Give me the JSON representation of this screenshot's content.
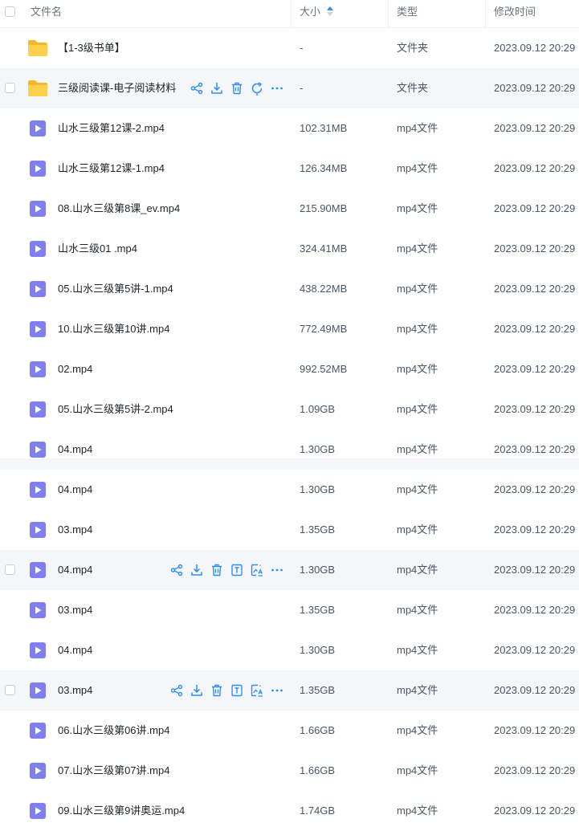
{
  "header": {
    "name_label": "文件名",
    "size_label": "大小",
    "type_label": "类型",
    "time_label": "修改时间"
  },
  "colors": {
    "accent": "#2b8ef6",
    "folder": "#f8c236",
    "video": "#7f7ff0"
  },
  "rows": [
    {
      "name": "【1-3级书单】",
      "size": "-",
      "type": "文件夹",
      "time": "2023.09.12 20:29",
      "icon": "folder-icon"
    },
    {
      "name": "三级阅读课-电子阅读材料",
      "size": "-",
      "type": "文件夹",
      "time": "2023.09.12 20:29",
      "icon": "folder-icon"
    },
    {
      "name": "山水三级第12课-2.mp4",
      "size": "102.31MB",
      "type": "mp4文件",
      "time": "2023.09.12 20:29",
      "icon": "video-file-icon"
    },
    {
      "name": "山水三级第12课-1.mp4",
      "size": "126.34MB",
      "type": "mp4文件",
      "time": "2023.09.12 20:29",
      "icon": "video-file-icon"
    },
    {
      "name": "08.山水三级第8课_ev.mp4",
      "size": "215.90MB",
      "type": "mp4文件",
      "time": "2023.09.12 20:29",
      "icon": "video-file-icon"
    },
    {
      "name": "山水三级01 .mp4",
      "size": "324.41MB",
      "type": "mp4文件",
      "time": "2023.09.12 20:29",
      "icon": "video-file-icon"
    },
    {
      "name": "05.山水三级第5讲-1.mp4",
      "size": "438.22MB",
      "type": "mp4文件",
      "time": "2023.09.12 20:29",
      "icon": "video-file-icon"
    },
    {
      "name": "10.山水三级第10讲.mp4",
      "size": "772.49MB",
      "type": "mp4文件",
      "time": "2023.09.12 20:29",
      "icon": "video-file-icon"
    },
    {
      "name": "02.mp4",
      "size": "992.52MB",
      "type": "mp4文件",
      "time": "2023.09.12 20:29",
      "icon": "video-file-icon"
    },
    {
      "name": "05.山水三级第5讲-2.mp4",
      "size": "1.09GB",
      "type": "mp4文件",
      "time": "2023.09.12 20:29",
      "icon": "video-file-icon"
    },
    {
      "name": "04.mp4",
      "size": "1.30GB",
      "type": "mp4文件",
      "time": "2023.09.12 20:29",
      "icon": "video-file-icon"
    },
    {
      "name": "04.mp4",
      "size": "1.30GB",
      "type": "mp4文件",
      "time": "2023.09.12 20:29",
      "icon": "video-file-icon"
    },
    {
      "name": "03.mp4",
      "size": "1.35GB",
      "type": "mp4文件",
      "time": "2023.09.12 20:29",
      "icon": "video-file-icon"
    },
    {
      "name": "04.mp4",
      "size": "1.30GB",
      "type": "mp4文件",
      "time": "2023.09.12 20:29",
      "icon": "video-file-icon"
    },
    {
      "name": "03.mp4",
      "size": "1.35GB",
      "type": "mp4文件",
      "time": "2023.09.12 20:29",
      "icon": "video-file-icon"
    },
    {
      "name": "04.mp4",
      "size": "1.30GB",
      "type": "mp4文件",
      "time": "2023.09.12 20:29",
      "icon": "video-file-icon"
    },
    {
      "name": "03.mp4",
      "size": "1.35GB",
      "type": "mp4文件",
      "time": "2023.09.12 20:29",
      "icon": "video-file-icon"
    },
    {
      "name": "06.山水三级第06讲.mp4",
      "size": "1.66GB",
      "type": "mp4文件",
      "time": "2023.09.12 20:29",
      "icon": "video-file-icon"
    },
    {
      "name": "07.山水三级第07讲.mp4",
      "size": "1.66GB",
      "type": "mp4文件",
      "time": "2023.09.12 20:29",
      "icon": "video-file-icon"
    },
    {
      "name": "09.山水三级第9讲奥运.mp4",
      "size": "1.74GB",
      "type": "mp4文件",
      "time": "2023.09.12 20:29",
      "icon": "video-file-icon"
    }
  ]
}
